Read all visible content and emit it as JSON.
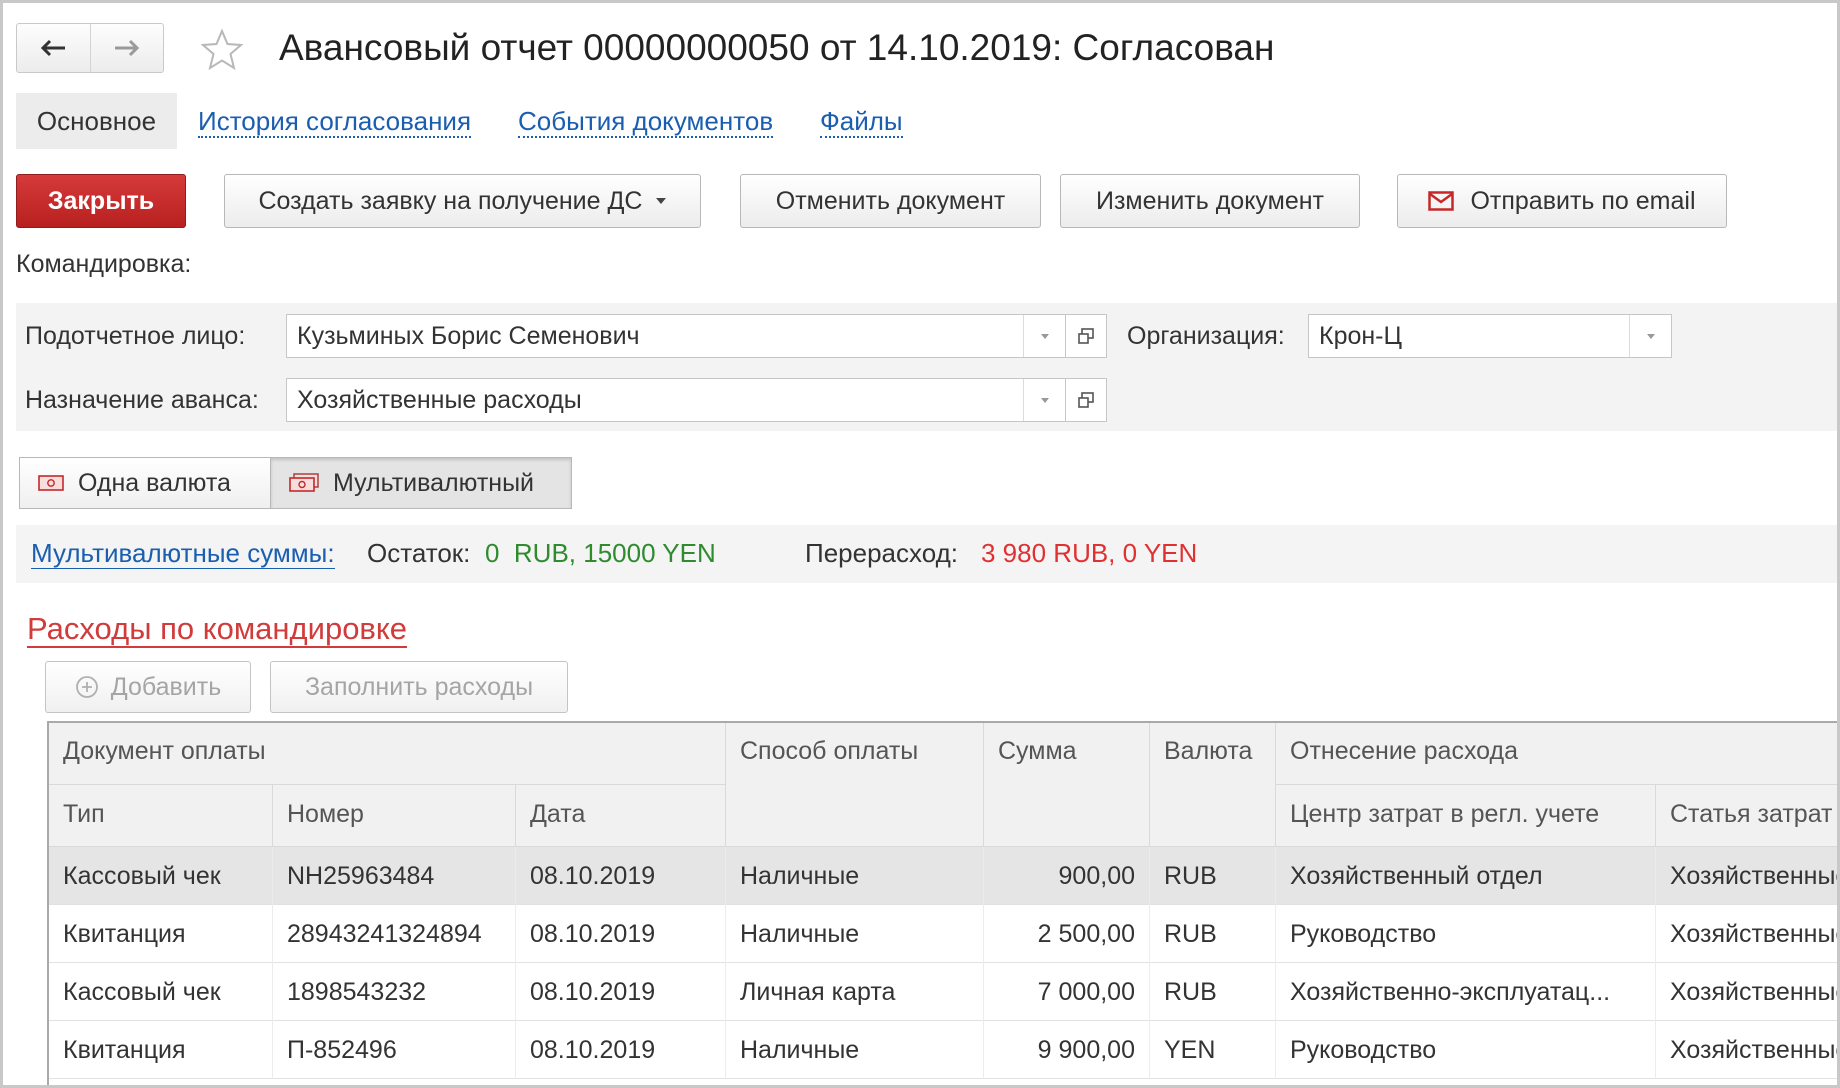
{
  "window": {
    "title": "Авансовый отчет 00000000050 от 14.10.2019: Согласован"
  },
  "tabs": [
    {
      "label": "Основное"
    },
    {
      "label": "История согласования"
    },
    {
      "label": "События документов"
    },
    {
      "label": "Файлы"
    }
  ],
  "toolbar": {
    "close_label": "Закрыть",
    "create_request_label": "Создать заявку на получение ДС",
    "cancel_doc_label": "Отменить документ",
    "edit_doc_label": "Изменить документ",
    "email_label": "Отправить по email"
  },
  "form": {
    "trip_label": "Командировка:",
    "person_label": "Подотчетное лицо:",
    "person_value": "Кузьминых Борис Семенович",
    "org_label": "Организация:",
    "org_value": "Крон-Ц",
    "purpose_label": "Назначение аванса:",
    "purpose_value": "Хозяйственные расходы"
  },
  "currency_mode": {
    "single_label": "Одна валюта",
    "multi_label": "Мультивалютный",
    "selected": "Мультивалютный"
  },
  "summary": {
    "link_label": "Мультивалютные суммы:",
    "remainder_label": "Остаток:",
    "remainder_value": "0  RUB, 15000 YEN",
    "overspend_label": "Перерасход:",
    "overspend_value": "3 980 RUB, 0 YEN",
    "remainder_color": "#2e8b2e",
    "overspend_color": "#e03030"
  },
  "expenses": {
    "title": "Расходы по командировке",
    "add_label": "Добавить",
    "fill_label": "Заполнить расходы",
    "group_headers": {
      "payment_doc": "Документ оплаты",
      "pay_method": "Способ оплаты",
      "amount": "Сумма",
      "currency": "Валюта",
      "allocation": "Отнесение расхода"
    },
    "sub_headers": {
      "type": "Тип",
      "number": "Номер",
      "date": "Дата",
      "cost_center": "Центр затрат в регл. учете",
      "cost_item": "Статья затрат"
    },
    "rows": [
      {
        "type": "Кассовый чек",
        "number": "NH25963484",
        "date": "08.10.2019",
        "method": "Наличные",
        "amount": "900,00",
        "currency": "RUB",
        "cost_center": "Хозяйственный отдел",
        "cost_item": "Хозяйственные расходы"
      },
      {
        "type": "Квитанция",
        "number": "28943241324894",
        "date": "08.10.2019",
        "method": "Наличные",
        "amount": "2 500,00",
        "currency": "RUB",
        "cost_center": "Руководство",
        "cost_item": "Хозяйственные расходы"
      },
      {
        "type": "Кассовый чек",
        "number": "1898543232",
        "date": "08.10.2019",
        "method": "Личная карта",
        "amount": "7 000,00",
        "currency": "RUB",
        "cost_center": "Хозяйственно-эксплуатац...",
        "cost_item": "Хозяйственные расходы"
      },
      {
        "type": "Квитанция",
        "number": "П-852496",
        "date": "08.10.2019",
        "method": "Наличные",
        "amount": "9 900,00",
        "currency": "YEN",
        "cost_center": "Руководство",
        "cost_item": "Хозяйственные расходы"
      }
    ]
  }
}
